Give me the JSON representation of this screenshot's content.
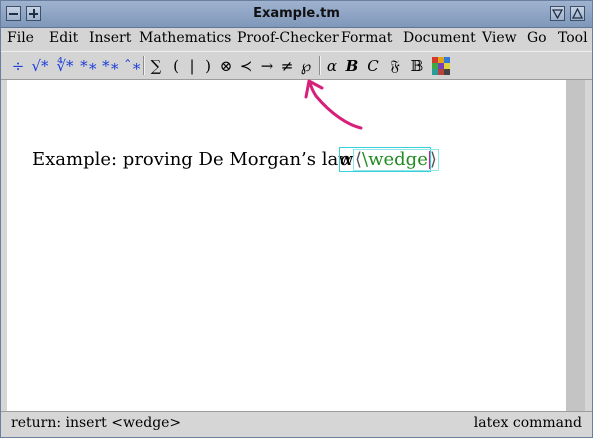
{
  "window": {
    "title": "Example.tm"
  },
  "menu": [
    "File",
    "Edit",
    "Insert",
    "Mathematics",
    "Proof-Checker",
    "Format",
    "Document",
    "View",
    "Go",
    "Tool"
  ],
  "toolbar": {
    "frac": "÷",
    "sqrt": "√*",
    "nroot": "∜*",
    "subscript": "*∗",
    "superscript": "*∗",
    "wide_accent": "ˆ∗",
    "sum": "∑",
    "paren_left": "(",
    "bar": "|",
    "paren_right": ")",
    "otimes": "⊗",
    "prec": "≺",
    "rightarrow": "→",
    "neq": "≠",
    "weierstrass": "℘",
    "alpha": "α",
    "bold_b": "B",
    "cal_c": "C",
    "frak_f": "𝔉",
    "bb_b": "𝔹"
  },
  "document": {
    "text": "Example: proving De Morgan’s law",
    "math_alpha": "α",
    "bracket_left": "⟨",
    "command": "\\wedge",
    "bracket_right": "⟩"
  },
  "status": {
    "left": "return: insert <wedge>",
    "right": "latex command"
  },
  "colors": {
    "annotation": "#d6207a",
    "command_text": "#1f8a1f",
    "focus_box": "#38d0d8",
    "toolbar_accent": "#1b3dd9"
  }
}
